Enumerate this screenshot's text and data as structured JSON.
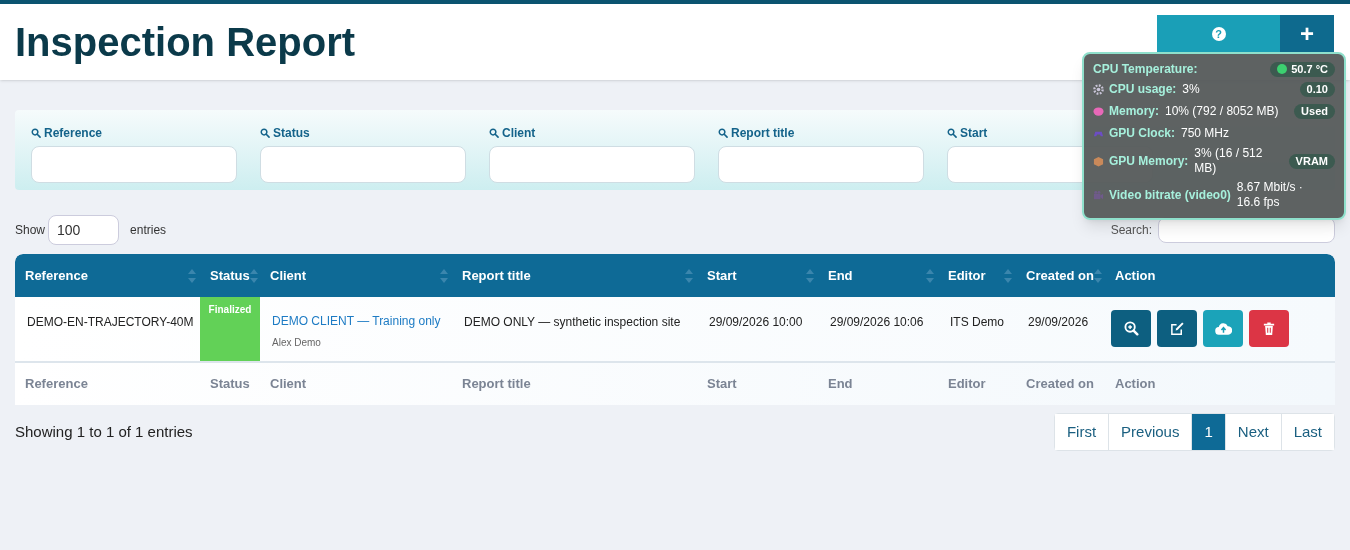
{
  "page": {
    "title": "Inspection Report"
  },
  "top_buttons": [
    {
      "kind": "help",
      "symbol": "?"
    },
    {
      "kind": "add",
      "symbol": "+"
    }
  ],
  "monitor": {
    "temperature_label": "CPU Temperature:",
    "temperature": "50.7 °C",
    "rows": [
      {
        "kind": "cpu",
        "label": "CPU usage:",
        "value": "3%",
        "badge": "0.10"
      },
      {
        "kind": "memory",
        "label": "Memory:",
        "value": "10% (792 / 8052 MB)",
        "badge": "Used"
      },
      {
        "kind": "gpu",
        "label": "GPU Clock:",
        "value": "750 MHz"
      },
      {
        "kind": "vram",
        "label": "GPU Memory:",
        "value": "3% (16 / 512 MB)",
        "badge": "VRAM"
      },
      {
        "kind": "video",
        "label": "Video bitrate (video0)",
        "value": "8.67 Mbit/s · 16.6 fps"
      }
    ]
  },
  "filters": [
    "Reference",
    "Status",
    "Client",
    "Report title",
    "Start"
  ],
  "length": {
    "before": "Show",
    "value": "100",
    "after": "entries"
  },
  "search": {
    "label": "Search:"
  },
  "table": {
    "columns": [
      {
        "label": "Reference",
        "sortable": true
      },
      {
        "label": "Status",
        "sortable": true
      },
      {
        "label": "Client",
        "sortable": true
      },
      {
        "label": "Report title",
        "sortable": true
      },
      {
        "label": "Start",
        "sortable": true
      },
      {
        "label": "End",
        "sortable": true
      },
      {
        "label": "Editor",
        "sortable": true
      },
      {
        "label": "Created on",
        "sortable": true
      },
      {
        "label": "Action",
        "sortable": false
      }
    ],
    "rows": [
      {
        "reference": "DEMO-EN-TRAJECTORY-40M",
        "status": "Finalized",
        "color": "#62d157",
        "client": "DEMO CLIENT — Training only",
        "client_contact": "Alex Demo",
        "report_title": "DEMO ONLY — synthetic inspection site",
        "start": "29/09/2026 10:00",
        "end": "29/09/2026 10:06",
        "editor": "ITS Demo",
        "created_on": "29/09/2026",
        "actions": [
          {
            "kind": "view"
          },
          {
            "kind": "edit"
          },
          {
            "kind": "upload"
          },
          {
            "kind": "delete"
          }
        ]
      }
    ],
    "footer": [
      "Reference",
      "Status",
      "Client",
      "Report title",
      "Start",
      "End",
      "Editor",
      "Created on",
      "Action"
    ]
  },
  "info": "Showing 1 to 1 of 1 entries",
  "pagination": [
    {
      "label": "First",
      "selected": false
    },
    {
      "label": "Previous",
      "selected": false
    },
    {
      "label": "1",
      "selected": true
    },
    {
      "label": "Next",
      "selected": false
    },
    {
      "label": "Last",
      "selected": false
    }
  ]
}
